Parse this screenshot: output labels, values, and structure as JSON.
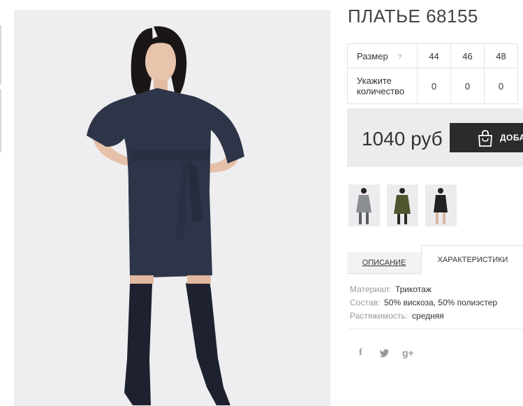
{
  "product": {
    "title": "ПЛАТЬЕ 68155",
    "price": "1040 руб",
    "add_button_label": "ДОБАВИТЬ"
  },
  "sizes_table": {
    "size_label": "Размер",
    "help_symbol": "?",
    "sizes": [
      "44",
      "46",
      "48"
    ],
    "quantity_label": "Укажите количество",
    "quantities": [
      "0",
      "0",
      "0"
    ]
  },
  "thumbnails": [
    {
      "name": "thumb-grey-dress",
      "dress_color": "#8a8d92"
    },
    {
      "name": "thumb-olive-dress",
      "dress_color": "#4e5630"
    },
    {
      "name": "thumb-black-dress",
      "dress_color": "#222222"
    }
  ],
  "tabs": {
    "description": "ОПИСАНИЕ",
    "characteristics": "ХАРАКТЕРИСТИКИ"
  },
  "properties": [
    {
      "key": "Материал:",
      "value": "Трикотаж"
    },
    {
      "key": "Состав:",
      "value": "50% вискоза, 50% полиэстер"
    },
    {
      "key": "Растяжимость:",
      "value": "средняя"
    }
  ],
  "social": {
    "facebook": "f",
    "twitter": "twitter-bird",
    "googleplus": "g+"
  },
  "colors": {
    "button_bg": "#2b2b2b",
    "buy_box_bg": "#ececec",
    "photo_bg": "#eeeef0",
    "dress": "#2e3548"
  }
}
